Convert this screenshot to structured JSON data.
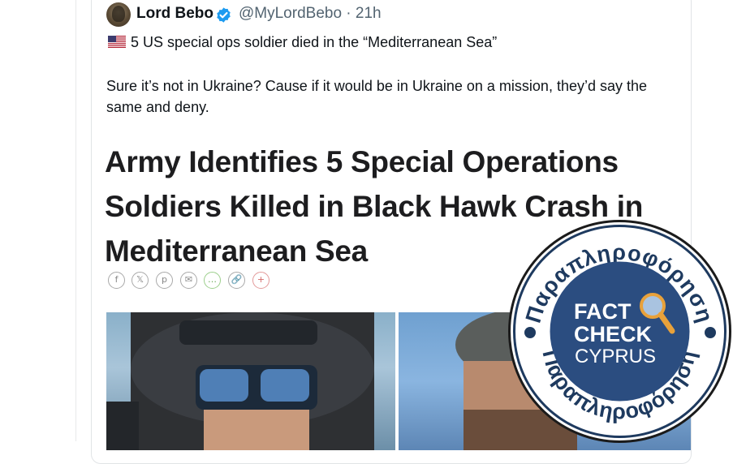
{
  "author": {
    "display_name": "Lord Bebo",
    "handle_time": "@MyLordBebo · 21h",
    "verified_icon": "verified-badge-icon",
    "avatar_icon": "profile-avatar"
  },
  "tweet": {
    "line1": "5 US special ops soldier died in the “Mediterranean Sea”",
    "flag_icon": "us-flag-emoji",
    "body": "Sure it’s not in Ukraine? Cause if it would be in Ukraine on a mission, they’d say the same and deny."
  },
  "article": {
    "headline": "Army Identifies 5 Special Operations Soldiers Killed in Black Hawk Crash in Mediterranean Sea",
    "share_icons": [
      {
        "name": "facebook-share-icon",
        "glyph": "f"
      },
      {
        "name": "x-share-icon",
        "glyph": "𝕏"
      },
      {
        "name": "pinterest-share-icon",
        "glyph": "p"
      },
      {
        "name": "email-share-icon",
        "glyph": "✉"
      },
      {
        "name": "sms-share-icon",
        "glyph": "…"
      },
      {
        "name": "link-share-icon",
        "glyph": "🔗"
      },
      {
        "name": "more-share-icon",
        "glyph": "+"
      }
    ]
  },
  "badge": {
    "top_arc": "Παραπληροφόρηση",
    "bottom_arc": "Παραπληροφόρηση",
    "line1": "FACT",
    "line2": "CHECK",
    "line3": "CYPRUS",
    "colors": {
      "navy": "#1e3a5f",
      "blue": "#2b4d80",
      "gold": "#e8a13a"
    },
    "icon": "magnifying-glass-icon"
  },
  "colors": {
    "text": "#0f1419",
    "muted": "#536471",
    "verified": "#1d9bf0"
  }
}
